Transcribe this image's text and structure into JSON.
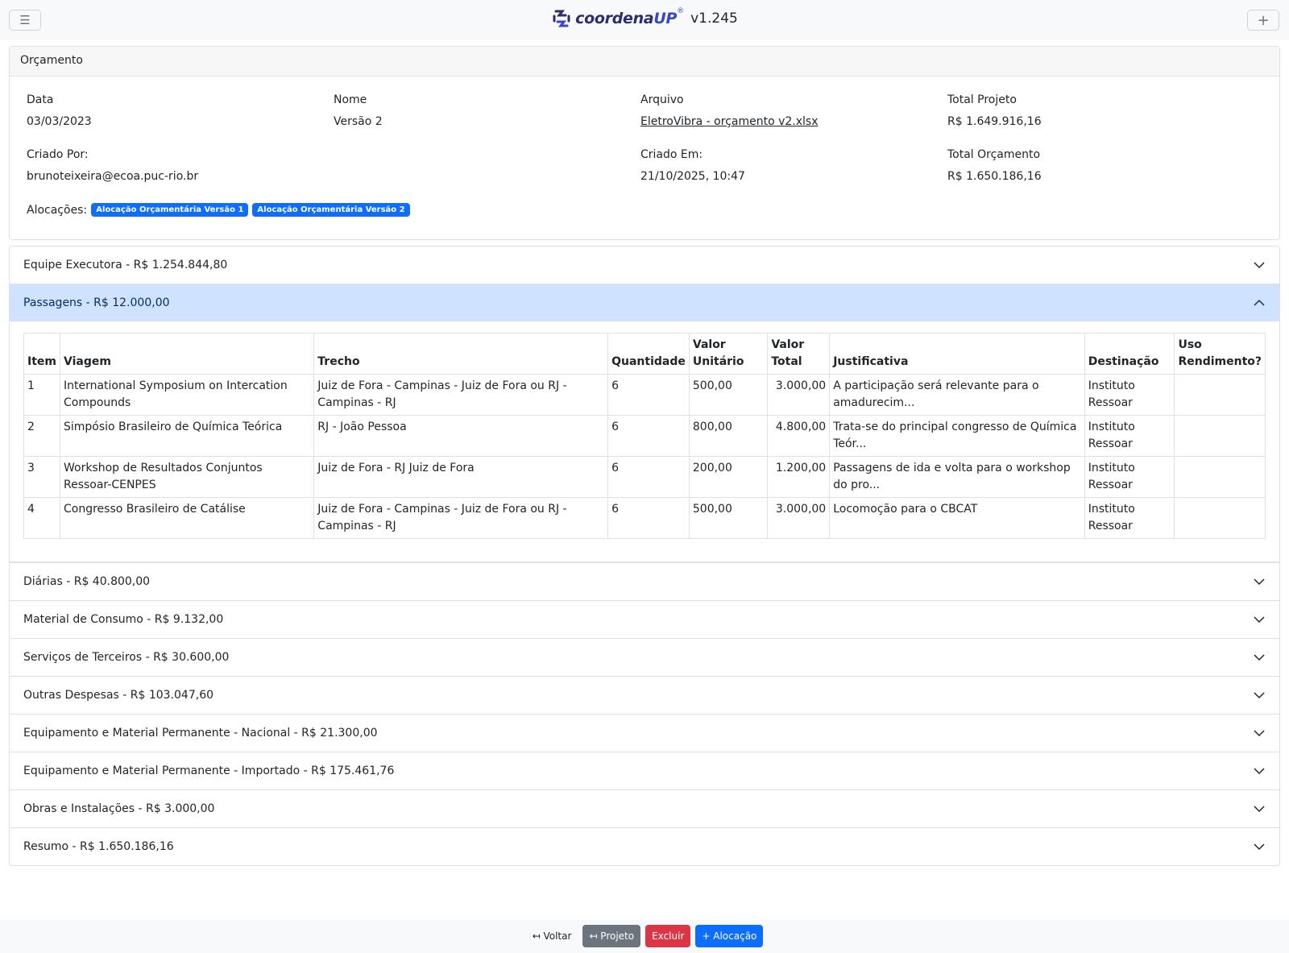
{
  "header": {
    "menu_icon": "hamburger-icon",
    "logo_prefix": "coordena",
    "logo_suffix": "UP",
    "logo_sup": "®",
    "version": "v1.245",
    "add_icon": "plus-icon"
  },
  "card": {
    "title": "Orçamento",
    "data_label": "Data",
    "data_value": "03/03/2023",
    "nome_label": "Nome",
    "nome_value": "Versão 2",
    "arquivo_label": "Arquivo",
    "arquivo_value": "EletroVibra - orçamento v2.xlsx",
    "total_projeto_label": "Total Projeto",
    "total_projeto_value": "R$ 1.649.916,16",
    "criado_por_label": "Criado Por:",
    "criado_por_value": "brunoteixeira@ecoa.puc-rio.br",
    "criado_em_label": "Criado Em:",
    "criado_em_value": "21/10/2025, 10:47",
    "total_orcamento_label": "Total Orçamento",
    "total_orcamento_value": "R$ 1.650.186,16",
    "alocacoes_label": "Alocações:",
    "alocacoes": [
      "Alocação Orçamentária Versão 1",
      "Alocação Orçamentária Versão 2"
    ]
  },
  "sections": [
    {
      "label": "Equipe Executora - R$ 1.254.844,80",
      "expanded": false
    },
    {
      "label": "Passagens - R$ 12.000,00",
      "expanded": true
    },
    {
      "label": "Diárias - R$ 40.800,00",
      "expanded": false
    },
    {
      "label": "Material de Consumo - R$ 9.132,00",
      "expanded": false
    },
    {
      "label": "Serviços de Terceiros - R$ 30.600,00",
      "expanded": false
    },
    {
      "label": "Outras Despesas - R$ 103.047,60",
      "expanded": false
    },
    {
      "label": "Equipamento e Material Permanente - Nacional - R$ 21.300,00",
      "expanded": false
    },
    {
      "label": "Equipamento e Material Permanente - Importado - R$ 175.461,76",
      "expanded": false
    },
    {
      "label": "Obras e Instalações - R$ 3.000,00",
      "expanded": false
    },
    {
      "label": "Resumo - R$ 1.650.186,16",
      "expanded": false
    }
  ],
  "passagens_table": {
    "columns": {
      "item": "Item",
      "viagem": "Viagem",
      "trecho": "Trecho",
      "quantidade": "Quantidade",
      "valor_unitario_1": "Valor",
      "valor_unitario_2": "Unitário",
      "valor_total_1": "Valor",
      "valor_total_2": "Total",
      "justificativa": "Justificativa",
      "destinacao": "Destinação",
      "uso_rendimento_1": "Uso",
      "uso_rendimento_2": "Rendimento?"
    },
    "rows": [
      {
        "item": "1",
        "viagem": "International Symposium on Intercation Compounds",
        "trecho": "Juiz de Fora - Campinas - Juiz de Fora ou RJ - Campinas - RJ",
        "quantidade": "6",
        "valor_unitario": "500,00",
        "valor_total": "3.000,00",
        "justificativa": "A participação será relevante para o amadurecim...",
        "destinacao": "Instituto Ressoar",
        "uso_rendimento": ""
      },
      {
        "item": "2",
        "viagem": "Simpósio Brasileiro de Química Teórica",
        "trecho": "RJ - João Pessoa",
        "quantidade": "6",
        "valor_unitario": "800,00",
        "valor_total": "4.800,00",
        "justificativa": "Trata-se do principal congresso de Química Teór...",
        "destinacao": "Instituto Ressoar",
        "uso_rendimento": ""
      },
      {
        "item": "3",
        "viagem": "Workshop de Resultados Conjuntos Ressoar-CENPES",
        "trecho": "Juiz de Fora - RJ Juiz de Fora",
        "quantidade": "6",
        "valor_unitario": "200,00",
        "valor_total": "1.200,00",
        "justificativa": "Passagens de ida e volta para o workshop do pro...",
        "destinacao": "Instituto Ressoar",
        "uso_rendimento": ""
      },
      {
        "item": "4",
        "viagem": "Congresso Brasileiro de Catálise",
        "trecho": "Juiz de Fora - Campinas - Juiz de Fora ou RJ - Campinas - RJ",
        "quantidade": "6",
        "valor_unitario": "500,00",
        "valor_total": "3.000,00",
        "justificativa": "Locomoção para o CBCAT",
        "destinacao": "Instituto Ressoar",
        "uso_rendimento": ""
      }
    ]
  },
  "footer": {
    "voltar": "↤ Voltar",
    "projeto": "↤ Projeto",
    "excluir": "Excluir",
    "alocacao": "+ Alocação"
  },
  "colors": {
    "primary": "#0d6efd",
    "danger": "#dc3545",
    "secondary": "#6c757d",
    "active_section_bg": "#cfe2ff",
    "logo": "#2b2d6e"
  }
}
